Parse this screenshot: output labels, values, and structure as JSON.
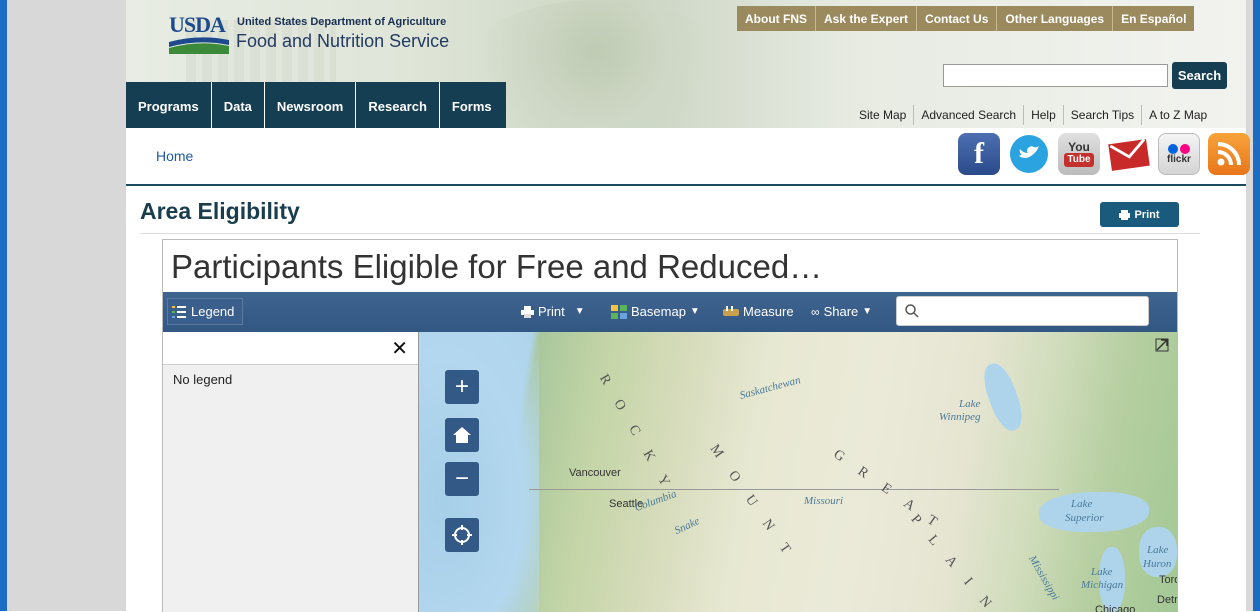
{
  "header": {
    "logo_usda": "USDA",
    "logo_dept": "United States Department of Agriculture",
    "logo_service": "Food and Nutrition Service",
    "top_links": [
      "About FNS",
      "Ask the Expert",
      "Contact Us",
      "Other Languages",
      "En Español"
    ],
    "search_placeholder": "",
    "search_button": "Search",
    "main_nav": [
      "Programs",
      "Data",
      "Newsroom",
      "Research",
      "Forms"
    ],
    "util_links": [
      "Site Map",
      "Advanced Search",
      "Help",
      "Search Tips",
      "A to Z Map"
    ],
    "social_icons": [
      "facebook-icon",
      "twitter-icon",
      "youtube-icon",
      "email-icon",
      "flickr-icon",
      "rss-icon"
    ]
  },
  "breadcrumb": {
    "home": "Home"
  },
  "page": {
    "title": "Area Eligibility",
    "print_label": "Print"
  },
  "map_app": {
    "title": "Participants Eligible for Free and Reduced…",
    "toolbar": {
      "legend": "Legend",
      "print": "Print",
      "basemap": "Basemap",
      "measure": "Measure",
      "share": "Share",
      "search_placeholder": ""
    },
    "legend_panel": {
      "empty_text": "No legend"
    },
    "map_labels": {
      "vancouver": "Vancouver",
      "seattle": "Seattle",
      "saskatchewan": "Saskatchewan",
      "lake_winnipeg_1": "Lake",
      "lake_winnipeg_2": "Winnipeg",
      "missouri": "Missouri",
      "columbia": "Columbia",
      "snake": "Snake",
      "lake_superior_1": "Lake",
      "lake_superior_2": "Superior",
      "lake_michigan_1": "Lake",
      "lake_michigan_2": "Michigan",
      "lake_huron_1": "Lake",
      "lake_huron_2": "Huron",
      "mississippi": "Mississippi",
      "toronto": "Toro",
      "detroit": "Detr",
      "chicago": "Chicago",
      "rocky": "R O C K Y",
      "mountains": "M O U N T",
      "great": "G R E A T",
      "plains": "P L A I N"
    }
  },
  "colors": {
    "nav_bg": "#153e52",
    "toolbar_bg": "#325783",
    "frame": "#1d6cc4",
    "top_nav_bg": "#9a8a5e"
  }
}
